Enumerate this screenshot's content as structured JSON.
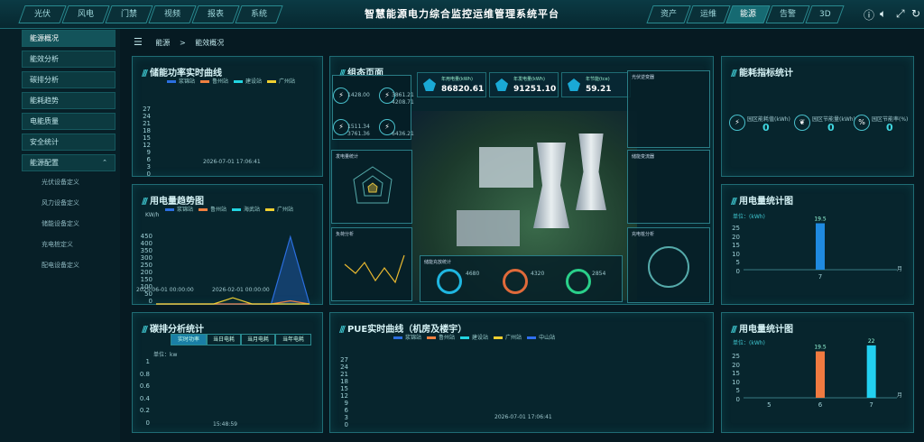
{
  "header": {
    "title": "智慧能源电力综合监控运维管理系统平台",
    "left_tabs": [
      "光伏",
      "风电",
      "门禁",
      "视频",
      "报表",
      "系统"
    ],
    "right_tabs": [
      "资产",
      "运维",
      "能源",
      "告警",
      "3D"
    ],
    "right_active": 2
  },
  "sidebar": {
    "items": [
      "能源概况",
      "能效分析",
      "碳排分析",
      "能耗趋势",
      "电能质量",
      "安全统计",
      "能源配置"
    ],
    "active": 0,
    "sub": [
      "光伏设备定义",
      "风力设备定义",
      "储能设备定义",
      "充电桩定义",
      "配电设备定义"
    ]
  },
  "breadcrumb": {
    "home": "能源",
    "sep": ">",
    "current": "能效概况"
  },
  "p1": {
    "title": "储能功率实时曲线",
    "legend": [
      "浆锦站",
      "鲁州站",
      "建设站",
      "广州站",
      "广州站2"
    ],
    "yticks": [
      "27",
      "24",
      "21",
      "18",
      "15",
      "12",
      "9",
      "6",
      "3",
      "0"
    ],
    "xlabel": "2026-07-01 17:06:41"
  },
  "p2": {
    "title": "用电量趋势图",
    "legend": [
      "浆锦站",
      "鲁州站",
      "海武站",
      "广州站"
    ],
    "unit": "KW/h",
    "yticks": [
      "450",
      "400",
      "350",
      "300",
      "250",
      "200",
      "150",
      "100",
      "50",
      "0"
    ],
    "x1": "2025-06-01 00:00:00",
    "x2": "2026-02-01 00:00:00"
  },
  "p3": {
    "title": "碳排分析统计",
    "tabs": [
      "实时功率",
      "当日电耗",
      "当月电耗",
      "当年电耗"
    ],
    "unit": "单位：kw",
    "yticks": [
      "1",
      "0.8",
      "0.6",
      "0.4",
      "0.2",
      "0"
    ],
    "xlabel": "15:48:59"
  },
  "center": {
    "title": "组态页面",
    "kpis": [
      {
        "label": "年用电量(kWh)",
        "value": "86820.61"
      },
      {
        "label": "年发电量(kWh)",
        "value": "91251.10"
      },
      {
        "label": "年节能(tce)",
        "value": "59.21"
      }
    ],
    "left_small": [
      {
        "val": "1428.00",
        "sub": "KW"
      },
      {
        "val": "3861.21",
        "sub": "KW"
      },
      {
        "val": "1511.34",
        "sub": "KW"
      },
      {
        "val": "4208.71",
        "sub": "KW"
      },
      {
        "val": "3761.36",
        "sub": "KW"
      },
      {
        "val": "6436.21",
        "sub": "KW"
      }
    ],
    "mini_titles": [
      "发电量统计",
      "负荷分析",
      "光伏逆变器",
      "储能变流器",
      "充电桩分析",
      "储能充放统计"
    ],
    "rings": [
      {
        "val": "4680",
        "pct": "0%"
      },
      {
        "val": "4320",
        "pct": "0%"
      },
      {
        "val": "2854",
        "pct": "0%"
      }
    ]
  },
  "p4": {
    "title": "PUE实时曲线（机房及楼宇）",
    "legend": [
      "浆锦站",
      "鲁州站",
      "建设站",
      "广州站",
      "中山站"
    ],
    "yticks": [
      "27",
      "24",
      "21",
      "18",
      "15",
      "12",
      "9",
      "6",
      "3",
      "0"
    ],
    "xlabel": "2026-07-01 17:06:41"
  },
  "p5": {
    "title": "能耗指标统计",
    "items": [
      {
        "label": "园区能耗值(kWh)",
        "value": "0"
      },
      {
        "label": "园区节能量(kWh)",
        "value": "0"
      },
      {
        "label": "园区节能率(%)",
        "value": "0"
      }
    ]
  },
  "p6": {
    "title": "用电量统计图",
    "unit": "单位：(kWh)",
    "yticks": [
      "25",
      "20",
      "15",
      "10",
      "5",
      "0"
    ],
    "cat": "7",
    "val_label": "19.5",
    "month": "月"
  },
  "p7": {
    "title": "用电量统计图",
    "unit": "单位：(kWh)",
    "yticks": [
      "25",
      "20",
      "15",
      "10",
      "5",
      "0"
    ],
    "cats": [
      "5",
      "6",
      "7"
    ],
    "labels": [
      "",
      "19.5",
      "22"
    ],
    "month": "月"
  },
  "chart_data": [
    {
      "type": "line",
      "title": "用电量趋势图",
      "ylabel": "KW/h",
      "x": [
        "2025-06-01 00:00:00",
        "2026-02-01 00:00:00"
      ],
      "ylim": [
        0,
        450
      ],
      "series": [
        {
          "name": "浆锦站",
          "values": [
            0,
            0,
            0,
            0,
            0,
            0,
            0,
            430,
            0
          ]
        },
        {
          "name": "鲁州站",
          "values": [
            0,
            0,
            0,
            0,
            0,
            0,
            0,
            20,
            0
          ]
        },
        {
          "name": "广州站",
          "values": [
            0,
            0,
            0,
            0,
            40,
            0,
            0,
            0,
            0
          ]
        }
      ]
    },
    {
      "type": "bar",
      "title": "用电量统计图",
      "categories": [
        "7"
      ],
      "values": [
        19.5
      ],
      "ylim": [
        0,
        25
      ]
    },
    {
      "type": "bar",
      "title": "用电量统计图",
      "categories": [
        "5",
        "6",
        "7"
      ],
      "values": [
        0,
        19.5,
        22
      ],
      "ylim": [
        0,
        25
      ]
    }
  ]
}
